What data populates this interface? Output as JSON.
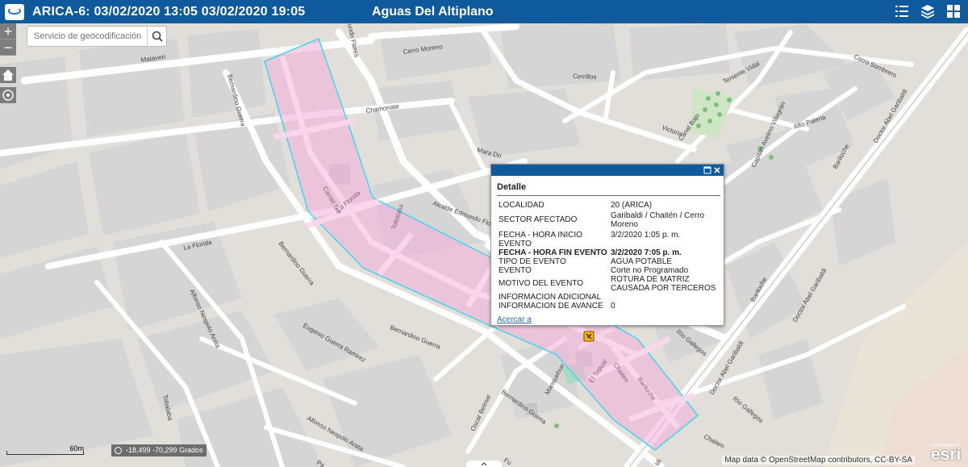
{
  "header": {
    "title": "ARICA-6: 03/02/2020 13:05 03/02/2020 19:05",
    "organization": "Aguas Del Altiplano",
    "icons": [
      "list-icon",
      "layers-icon",
      "basemap-grid-icon"
    ]
  },
  "search": {
    "placeholder": "Servicio de geocodificación"
  },
  "zoom": {
    "in_label": "+",
    "out_label": "−"
  },
  "popup": {
    "title": "Detalle",
    "rows": [
      {
        "key": "LOCALIDAD",
        "value": "20 (ARICA)"
      },
      {
        "key": "SECTOR AFECTADO",
        "value": "Garibaldi / Chaitén / Cerro Moreno"
      },
      {
        "key": "FECHA - HORA INICIO EVENTO",
        "value": "3/2/2020 1:05 p. m."
      },
      {
        "key": "FECHA - HORA FIN EVENTO",
        "value": "3/2/2020 7:05 p. m."
      },
      {
        "key": "TIPO DE EVENTO",
        "value": "AGUA POTABLE"
      },
      {
        "key": "EVENTO",
        "value": "Corte no Programado"
      },
      {
        "key": "MOTIVO DEL EVENTO",
        "value": "ROTURA DE MATRIZ CAUSADA POR TERCEROS"
      },
      {
        "key": "INFORMACION ADICIONAL",
        "value": ""
      },
      {
        "key": "INFORMACION DE AVANCE",
        "value": "0"
      }
    ],
    "zoom_link": "Acercar a"
  },
  "scale": {
    "label": "60m"
  },
  "coordinates": {
    "text": "-18,499 -70,299 Grados"
  },
  "attribution": "Map data © OpenStreetMap contributors, CC-BY-SA",
  "esri": {
    "powered": "POWERED BY",
    "brand": "esri"
  },
  "streets": {
    "mataveri": "Mataveri",
    "cerro_moreno": "Cerro Moreno",
    "cerrillos": "Cerrillos",
    "chamonate": "Chamonate",
    "bernardino_guerra": "Bernardino Guerra",
    "raimundo_flores": "undo Flores",
    "teniente_vidal": "Teniente Vidal",
    "cerro_sombrero": "Cerro Sombrero",
    "doctor_abel_garibaldi": "Doctor Abel Garibaldi",
    "victoria": "Victoria",
    "canal_bajo": "Canal Bajo",
    "alto_palena": "Alto Palena",
    "capitan_avelino": "Capitán Avelino Villagrán",
    "bariloche": "Bariloche",
    "mara_dona": "Mara Do",
    "alcalde": "Alcalde Edmundo Flo",
    "la_florida": "La Florida",
    "carriel_sur": "Carriel Sur",
    "tobalaba": "Tobalaba",
    "alfonso_nespolo": "Alfonso Nespolo Arata",
    "eugenio_guerra": "Eugenio Guerra Ramirez",
    "manquehue": "Manquehue",
    "oscar_belmar": "Oscar Belmar",
    "el_tepual": "El Tepual",
    "chaiten": "Chaiten",
    "rio_gallegos": "Río Gallegos",
    "pa": "Pa",
    "fu": "Fu",
    "ldi": "ldi"
  }
}
